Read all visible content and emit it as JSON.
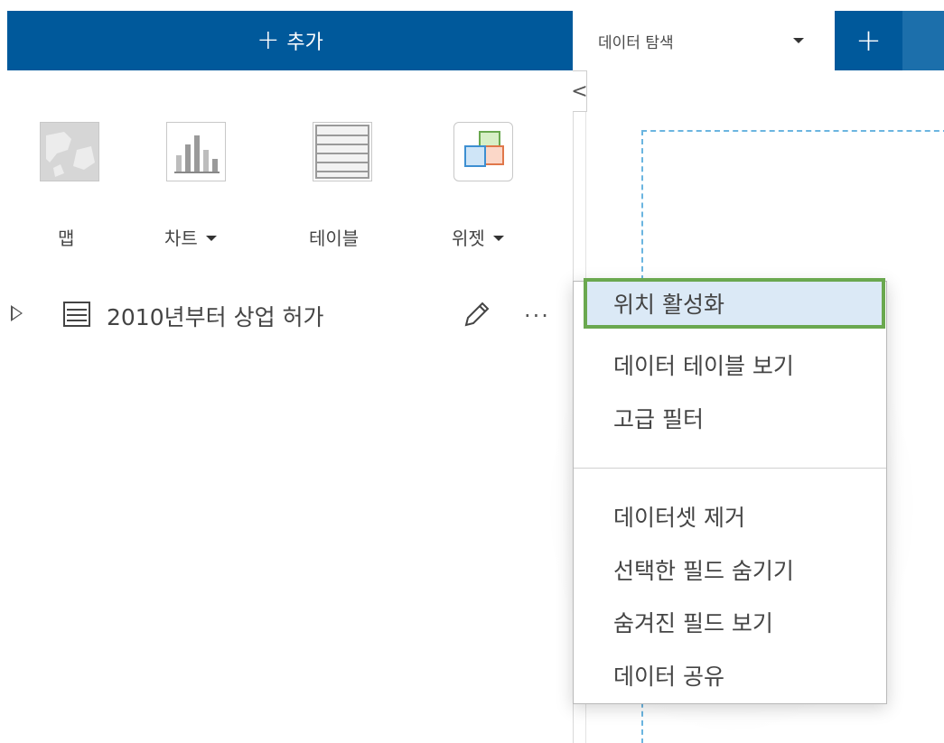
{
  "header": {
    "add_label": "추가",
    "tab_label": "데이터 탐색",
    "tab_add_symbol": "+"
  },
  "viz_panel": {
    "items": [
      {
        "label": "맵",
        "icon": "map-icon",
        "has_dropdown": false
      },
      {
        "label": "차트",
        "icon": "bar-chart-icon",
        "has_dropdown": true
      },
      {
        "label": "테이블",
        "icon": "table-icon",
        "has_dropdown": false
      },
      {
        "label": "위젯",
        "icon": "widget-icon",
        "has_dropdown": true
      }
    ]
  },
  "dataset": {
    "name": "2010년부터 상업 허가",
    "more_symbol": "···"
  },
  "canvas": {
    "collapse_symbol": "<"
  },
  "context_menu": {
    "items": [
      {
        "label": "위치 활성화",
        "highlighted": true
      },
      {
        "label": "데이터 테이블 보기"
      },
      {
        "label": "고급 필터"
      },
      {
        "label": "데이터셋 제거"
      },
      {
        "label": "선택한 필드 숨기기"
      },
      {
        "label": "숨겨진 필드 보기"
      },
      {
        "label": "데이터 공유"
      }
    ]
  },
  "colors": {
    "brand_blue": "#00599b",
    "highlight_green": "#6aa84f",
    "highlight_fill": "#dbe9f6",
    "dashed_blue": "#6bb5e0"
  }
}
